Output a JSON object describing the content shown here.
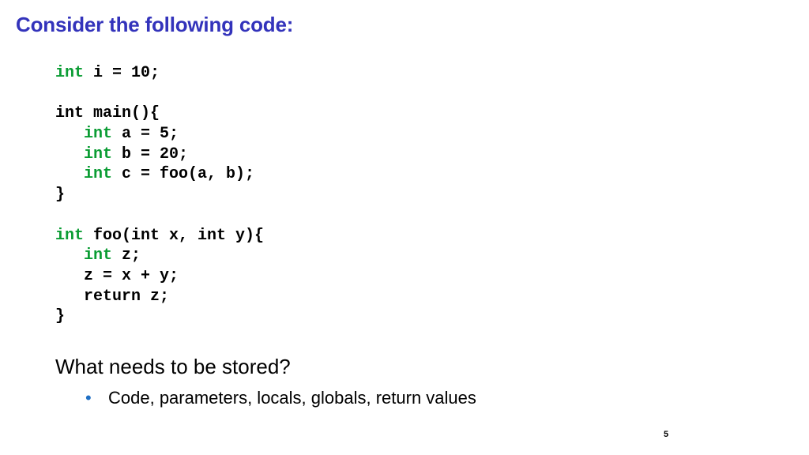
{
  "slide": {
    "title": "Consider the following code:",
    "title_color": "#3333bb",
    "background_color": "#ffffff",
    "page_number": "5"
  },
  "code": {
    "keyword_color": "#0a9c33",
    "text_color": "#000000",
    "lines": [
      {
        "indent": 0,
        "tokens": [
          {
            "t": "int",
            "c": "kw"
          },
          {
            "t": " i = 10;",
            "c": "plain"
          }
        ]
      },
      {
        "indent": 0,
        "blank": true,
        "tokens": []
      },
      {
        "indent": 0,
        "tokens": [
          {
            "t": "int main(){",
            "c": "plain"
          }
        ]
      },
      {
        "indent": 1,
        "tokens": [
          {
            "t": "int",
            "c": "kw"
          },
          {
            "t": " a = 5;",
            "c": "plain"
          }
        ]
      },
      {
        "indent": 1,
        "tokens": [
          {
            "t": "int",
            "c": "kw"
          },
          {
            "t": " b = 20;",
            "c": "plain"
          }
        ]
      },
      {
        "indent": 1,
        "tokens": [
          {
            "t": "int",
            "c": "kw"
          },
          {
            "t": " c = foo(a, b);",
            "c": "plain"
          }
        ]
      },
      {
        "indent": 0,
        "tokens": [
          {
            "t": "}",
            "c": "plain"
          }
        ]
      },
      {
        "indent": 0,
        "blank": true,
        "tokens": []
      },
      {
        "indent": 0,
        "tokens": [
          {
            "t": "int",
            "c": "kw"
          },
          {
            "t": " foo(int x, int y){",
            "c": "plain"
          }
        ]
      },
      {
        "indent": 1,
        "tokens": [
          {
            "t": "int",
            "c": "kw"
          },
          {
            "t": " z;",
            "c": "plain"
          }
        ]
      },
      {
        "indent": 1,
        "tokens": [
          {
            "t": "z = x + y;",
            "c": "plain"
          }
        ]
      },
      {
        "indent": 1,
        "tokens": [
          {
            "t": "return z;",
            "c": "plain"
          }
        ]
      },
      {
        "indent": 0,
        "tokens": [
          {
            "t": "}",
            "c": "plain"
          }
        ]
      }
    ],
    "full_text": "int i = 10;\n\nint main(){\n   int a = 5;\n   int b = 20;\n   int c = foo(a, b);\n}\n\nint foo(int x, int y){\n   int z;\n   z = x + y;\n   return z;\n}"
  },
  "body": {
    "question": "What needs to be stored?",
    "bullet_marker": "•",
    "bullet_color": "#1f6fc4",
    "bullet_text": "Code, parameters, locals, globals, return values"
  }
}
